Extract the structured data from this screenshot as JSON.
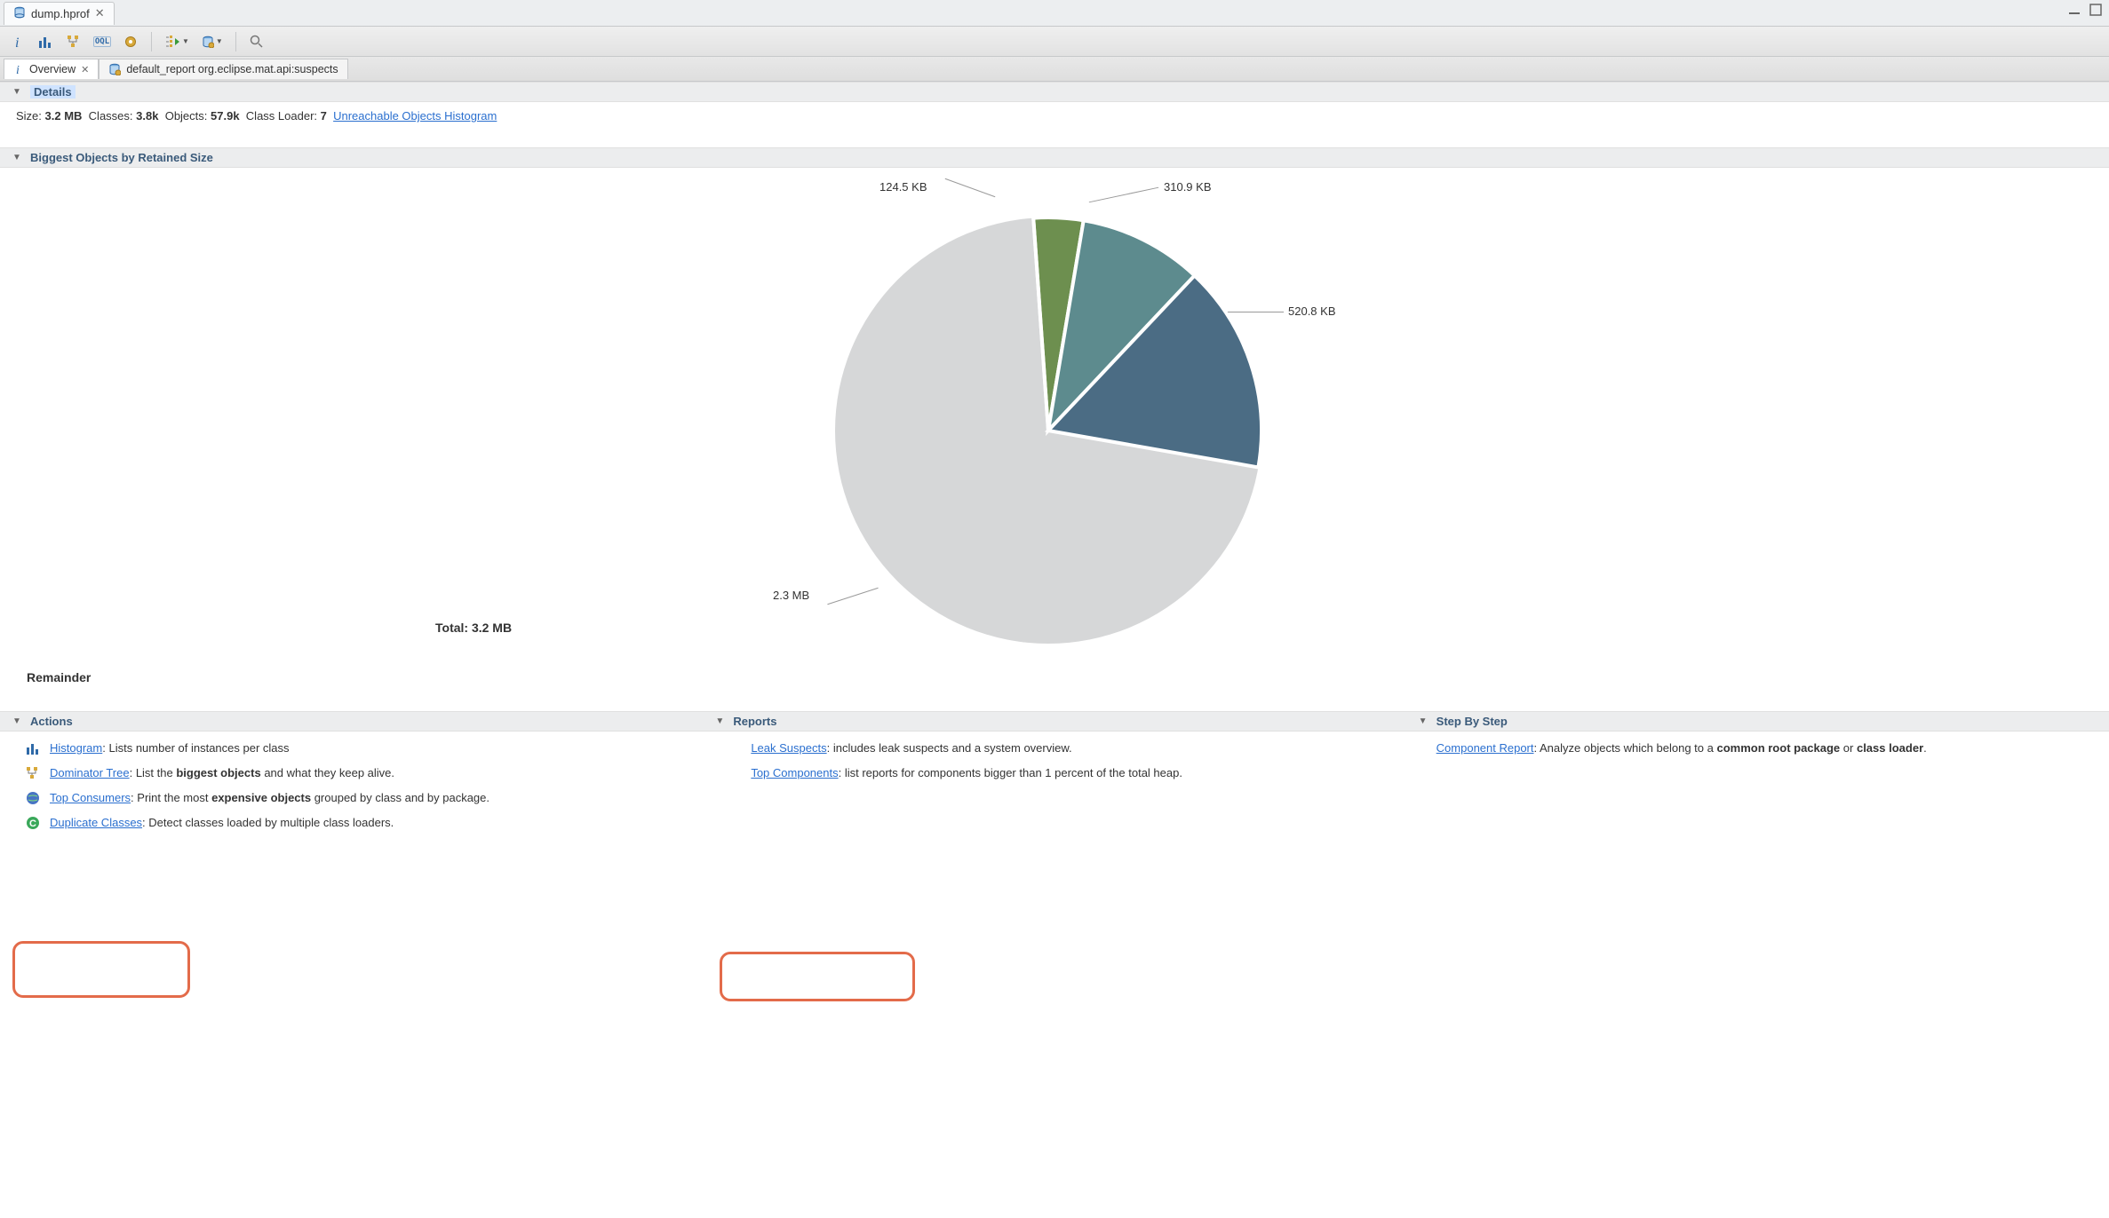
{
  "tab": {
    "filename": "dump.hprof"
  },
  "toolbar": {
    "items": [
      "info",
      "histogram",
      "tree",
      "oql",
      "gear",
      "play-tree",
      "db",
      "search"
    ]
  },
  "subtabs": {
    "overview": "Overview",
    "default_report": "default_report  org.eclipse.mat.api:suspects"
  },
  "sections": {
    "details": "Details",
    "biggest": "Biggest Objects by Retained Size",
    "actions": "Actions",
    "reports": "Reports",
    "step": "Step By Step"
  },
  "details": {
    "size_label": "Size:",
    "size": "3.2 MB",
    "classes_label": "Classes:",
    "classes": "3.8k",
    "objects_label": "Objects:",
    "objects": "57.9k",
    "classloader_label": "Class Loader:",
    "classloader": "7",
    "link": "Unreachable Objects Histogram"
  },
  "chart_data": {
    "type": "pie",
    "title": "Biggest Objects by Retained Size",
    "slices": [
      {
        "label": "Remainder",
        "value_kb": 2355.2,
        "display": "2.3 MB",
        "color": "#d6d7d8"
      },
      {
        "label": "slice-green",
        "value_kb": 124.5,
        "display": "124.5 KB",
        "color": "#6d8f4f"
      },
      {
        "label": "slice-teal",
        "value_kb": 310.9,
        "display": "310.9 KB",
        "color": "#5d8b8e"
      },
      {
        "label": "slice-blue",
        "value_kb": 520.8,
        "display": "520.8 KB",
        "color": "#4b6c84"
      }
    ],
    "total_label": "Total: 3.2 MB",
    "total_kb": 3276.8,
    "remainder_label": "Remainder"
  },
  "actions": {
    "histogram": {
      "link": "Histogram",
      "desc": ": Lists number of instances per class"
    },
    "dominator": {
      "link": "Dominator Tree",
      "desc_pre": ": List the ",
      "desc_bold": "biggest objects",
      "desc_post": " and what they keep alive."
    },
    "top_consumers": {
      "link": "Top Consumers",
      "desc_pre": ": Print the most ",
      "desc_bold": "expensive objects",
      "desc_post": " grouped by class and by package."
    },
    "duplicate": {
      "link": "Duplicate Classes",
      "desc": ": Detect classes loaded by multiple class loaders."
    }
  },
  "reports": {
    "leak": {
      "link": "Leak Suspects",
      "desc": ": includes leak suspects and a system overview."
    },
    "topcomp": {
      "link": "Top Components",
      "desc": ": list reports for components bigger than 1 percent of the total heap."
    }
  },
  "step": {
    "component": {
      "link": "Component Report",
      "desc_pre": ": Analyze objects which belong to a ",
      "desc_bold1": "common root package",
      "desc_mid": " or ",
      "desc_bold2": "class loader",
      "desc_post": "."
    }
  }
}
